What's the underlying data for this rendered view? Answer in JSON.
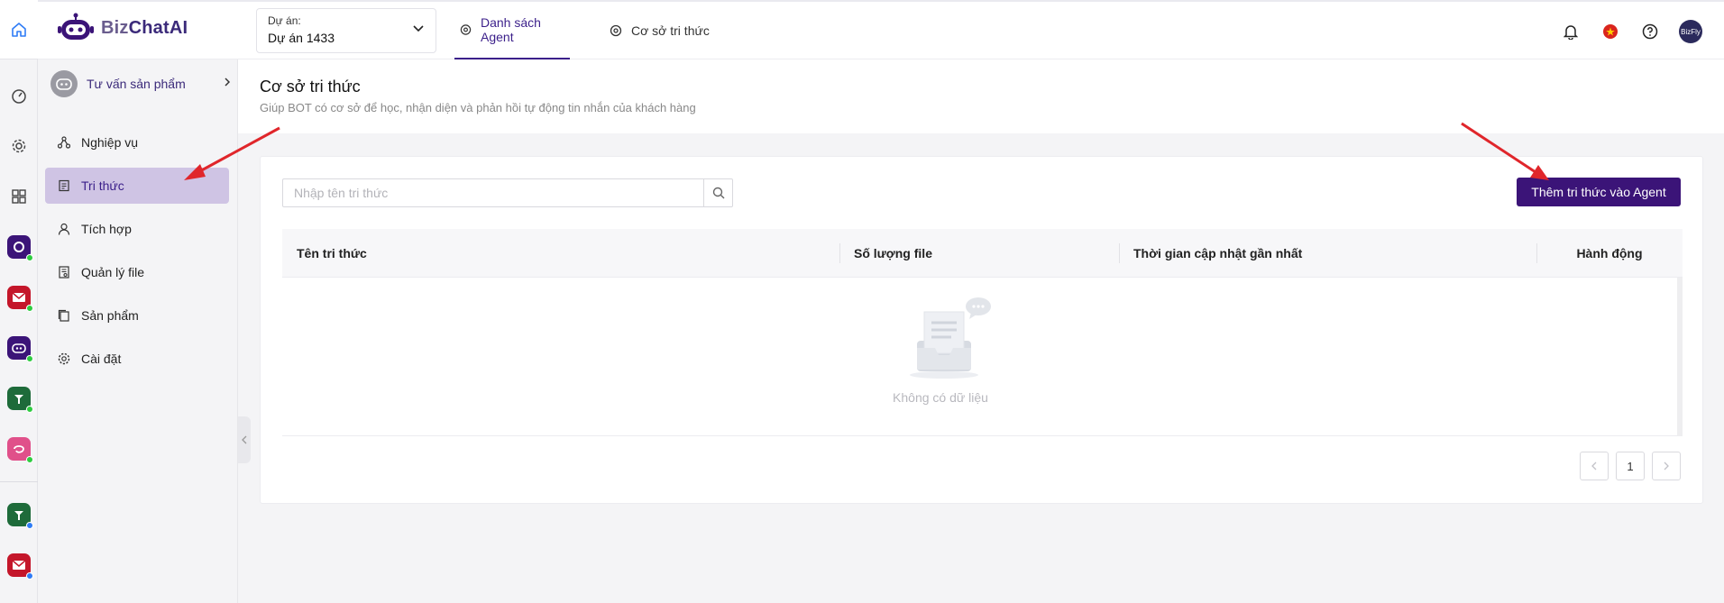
{
  "brand": {
    "name_part1": "Biz",
    "name_part2": "ChatAI"
  },
  "project": {
    "label": "Dự án:",
    "value": "Dự án 1433"
  },
  "tabs": [
    {
      "label": "Danh sách Agent",
      "active": true
    },
    {
      "label": "Cơ sở tri thức",
      "active": false
    }
  ],
  "header_icons": [
    "bell-icon",
    "vietnam-flag-icon",
    "help-icon",
    "avatar"
  ],
  "avatar_text": "BizFly",
  "sidebar": {
    "agent_name": "Tư vấn sản phẩm",
    "items": [
      {
        "label": "Nghiệp vụ",
        "icon": "workflow-icon",
        "active": false
      },
      {
        "label": "Tri thức",
        "icon": "document-icon",
        "active": true
      },
      {
        "label": "Tích hợp",
        "icon": "user-icon",
        "active": false
      },
      {
        "label": "Quản lý file",
        "icon": "file-icon",
        "active": false
      },
      {
        "label": "Sản phẩm",
        "icon": "product-icon",
        "active": false
      },
      {
        "label": "Cài đặt",
        "icon": "gear-icon",
        "active": false
      }
    ]
  },
  "page": {
    "title": "Cơ sở tri thức",
    "subtitle": "Giúp BOT có cơ sở để học, nhận diện và phản hồi tự động tin nhắn của khách hàng"
  },
  "search": {
    "placeholder": "Nhập tên tri thức",
    "value": ""
  },
  "add_button": "Thêm tri thức vào Agent",
  "table": {
    "columns": [
      "Tên tri thức",
      "Số lượng file",
      "Thời gian cập nhật gần nhất",
      "Hành động"
    ],
    "rows": [],
    "empty_text": "Không có dữ liệu"
  },
  "pagination": {
    "current_page": "1"
  },
  "colors": {
    "primary": "#3b1478",
    "active_bg": "#cfc4e4",
    "annotation_arrow": "#e0262b"
  }
}
